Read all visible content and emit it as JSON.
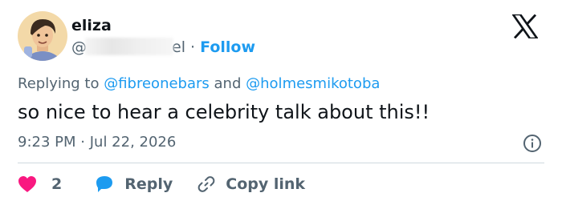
{
  "author": {
    "name": "eliza",
    "handle_prefix": "@",
    "handle_suffix": "el",
    "separator": "·",
    "follow_label": "Follow"
  },
  "reply_context": {
    "prefix": "Replying to",
    "mentions": [
      "@fibreonebars",
      "@holmesmikotoba"
    ],
    "conjunction": "and"
  },
  "tweet": {
    "text": "so nice to hear a celebrity talk about this!!",
    "time": "9:23 PM",
    "separator": "·",
    "date": "Jul 22, 2026"
  },
  "actions": {
    "like_count": "2",
    "reply_label": "Reply",
    "copy_link_label": "Copy link"
  },
  "colors": {
    "accent": "#1d9bf0",
    "muted": "#536471",
    "text": "#0f1419",
    "like": "#f91880",
    "divider": "#cfd9de"
  },
  "icons": {
    "logo": "x-logo-icon",
    "info": "info-icon",
    "like": "heart-icon",
    "reply": "speech-bubble-icon",
    "copy": "link-icon"
  }
}
